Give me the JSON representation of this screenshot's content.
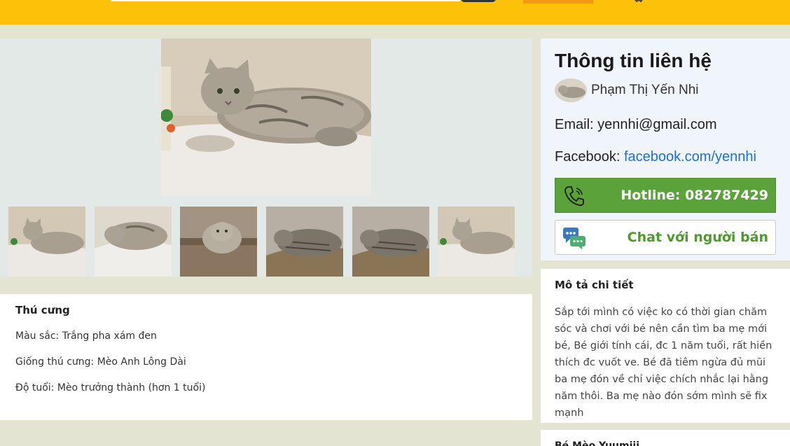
{
  "gallery": {
    "thumbnail_count": 6
  },
  "pet_info": {
    "heading": "Thú cưng",
    "color": "Màu sắc: Trắng pha xám đen",
    "breed": "Giống thú cưng: Mèo Anh Lông Dài",
    "age": "Độ tuổi: Mèo trưởng thành (hơn 1 tuổi)"
  },
  "contact": {
    "title": "Thông tin liên hệ",
    "seller_name": "Phạm Thị Yến Nhi",
    "email_label": "Email: ",
    "email": "yennhi@gmail.com",
    "facebook_label": "Facebook: ",
    "facebook": "facebook.com/yennhi",
    "hotline_label": "Hotline: 082787429",
    "chat_label": "Chat với người bán"
  },
  "description": {
    "heading": "Mô tả chi tiết",
    "text": "Sắp tới mình có việc ko có thời gian chăm sóc và chơi với bé nên cần tìm ba mẹ mới bé, Bé giới tính cái, đc 1 năm tuổi, rất hiền thích đc vuốt ve. Bé đã tiêm ngừa đủ mũi ba mẹ đón về chỉ việc chích nhắc lại hằng năm thôi. Ba mẹ nào đón sớm mình sẽ fix mạnh"
  },
  "next_card": {
    "title": "Bé Mèo Yuumiii"
  },
  "colors": {
    "header": "#fcc108",
    "hotline": "#5ba23b",
    "chat_text": "#4e9a2c",
    "link": "#1f6fd6"
  }
}
